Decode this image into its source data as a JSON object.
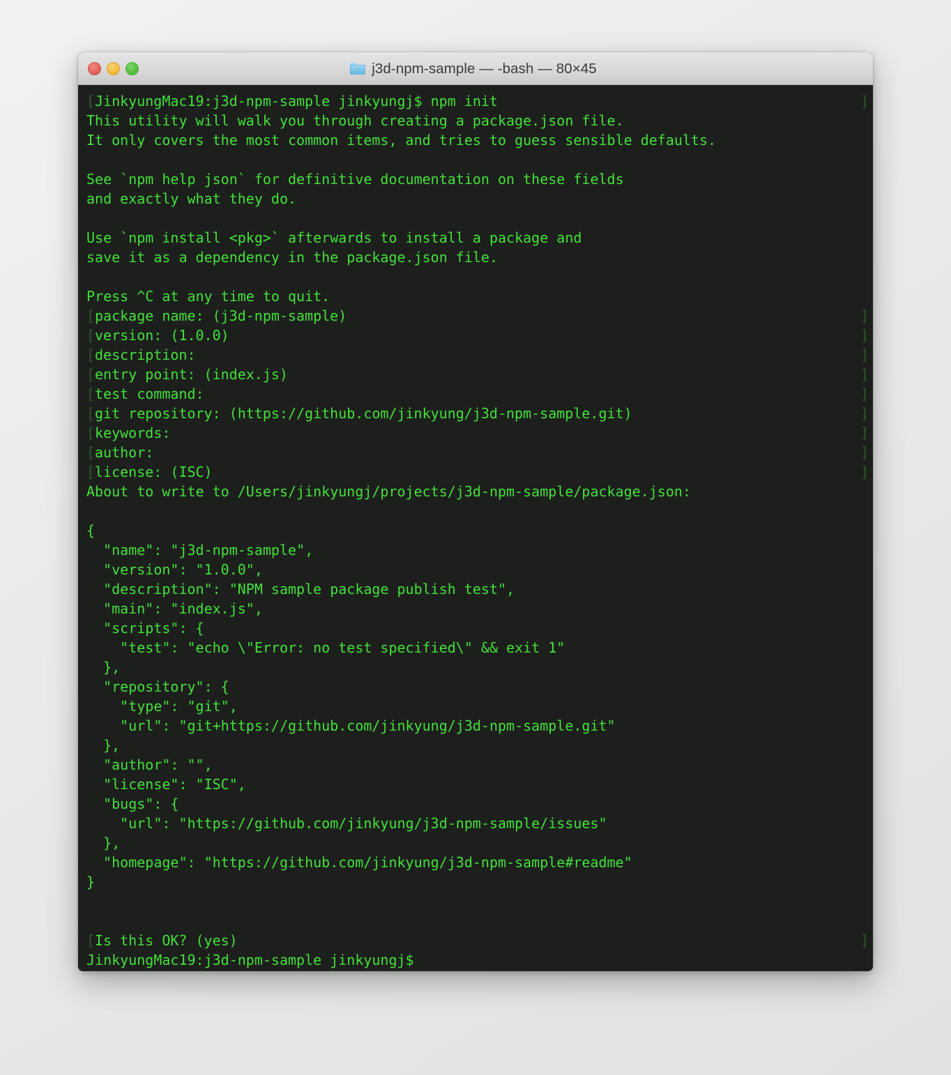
{
  "window": {
    "title": "j3d-npm-sample — -bash — 80×45",
    "folder_icon": "folder-icon",
    "traffic_lights": {
      "close_label": "close",
      "minimize_label": "minimize",
      "maximize_label": "maximize",
      "close_color": "#e5655c",
      "minimize_color": "#f4bc3e",
      "maximize_color": "#58c043"
    },
    "shell": "-bash",
    "dimensions": "80×45",
    "folder_name": "j3d-npm-sample"
  },
  "terminal": {
    "background_color": "#1d1f1d",
    "foreground_color": "#43e03a",
    "marker_color": "#2e5c2c",
    "font_size_px": 20,
    "line_height_px": 28,
    "lines": [
      {
        "text": "JinkyungMac19:j3d-npm-sample jinkyungj$ npm init",
        "marked": true
      },
      {
        "text": "This utility will walk you through creating a package.json file.",
        "marked": false
      },
      {
        "text": "It only covers the most common items, and tries to guess sensible defaults.",
        "marked": false
      },
      {
        "text": "",
        "marked": false
      },
      {
        "text": "See `npm help json` for definitive documentation on these fields",
        "marked": false
      },
      {
        "text": "and exactly what they do.",
        "marked": false
      },
      {
        "text": "",
        "marked": false
      },
      {
        "text": "Use `npm install <pkg>` afterwards to install a package and",
        "marked": false
      },
      {
        "text": "save it as a dependency in the package.json file.",
        "marked": false
      },
      {
        "text": "",
        "marked": false
      },
      {
        "text": "Press ^C at any time to quit.",
        "marked": false
      },
      {
        "text": "package name: (j3d-npm-sample)",
        "marked": true
      },
      {
        "text": "version: (1.0.0)",
        "marked": true
      },
      {
        "text": "description:",
        "marked": true
      },
      {
        "text": "entry point: (index.js)",
        "marked": true
      },
      {
        "text": "test command:",
        "marked": true
      },
      {
        "text": "git repository: (https://github.com/jinkyung/j3d-npm-sample.git)",
        "marked": true
      },
      {
        "text": "keywords:",
        "marked": true
      },
      {
        "text": "author:",
        "marked": true
      },
      {
        "text": "license: (ISC)",
        "marked": true
      },
      {
        "text": "About to write to /Users/jinkyungj/projects/j3d-npm-sample/package.json:",
        "marked": false
      },
      {
        "text": "",
        "marked": false
      },
      {
        "text": "{",
        "marked": false
      },
      {
        "text": "  \"name\": \"j3d-npm-sample\",",
        "marked": false
      },
      {
        "text": "  \"version\": \"1.0.0\",",
        "marked": false
      },
      {
        "text": "  \"description\": \"NPM sample package publish test\",",
        "marked": false
      },
      {
        "text": "  \"main\": \"index.js\",",
        "marked": false
      },
      {
        "text": "  \"scripts\": {",
        "marked": false
      },
      {
        "text": "    \"test\": \"echo \\\"Error: no test specified\\\" && exit 1\"",
        "marked": false
      },
      {
        "text": "  },",
        "marked": false
      },
      {
        "text": "  \"repository\": {",
        "marked": false
      },
      {
        "text": "    \"type\": \"git\",",
        "marked": false
      },
      {
        "text": "    \"url\": \"git+https://github.com/jinkyung/j3d-npm-sample.git\"",
        "marked": false
      },
      {
        "text": "  },",
        "marked": false
      },
      {
        "text": "  \"author\": \"\",",
        "marked": false
      },
      {
        "text": "  \"license\": \"ISC\",",
        "marked": false
      },
      {
        "text": "  \"bugs\": {",
        "marked": false
      },
      {
        "text": "    \"url\": \"https://github.com/jinkyung/j3d-npm-sample/issues\"",
        "marked": false
      },
      {
        "text": "  },",
        "marked": false
      },
      {
        "text": "  \"homepage\": \"https://github.com/jinkyung/j3d-npm-sample#readme\"",
        "marked": false
      },
      {
        "text": "}",
        "marked": false
      },
      {
        "text": "",
        "marked": false
      },
      {
        "text": "",
        "marked": false
      },
      {
        "text": "Is this OK? (yes)",
        "marked": true
      },
      {
        "text": "JinkyungMac19:j3d-npm-sample jinkyungj$",
        "marked": false
      }
    ]
  }
}
